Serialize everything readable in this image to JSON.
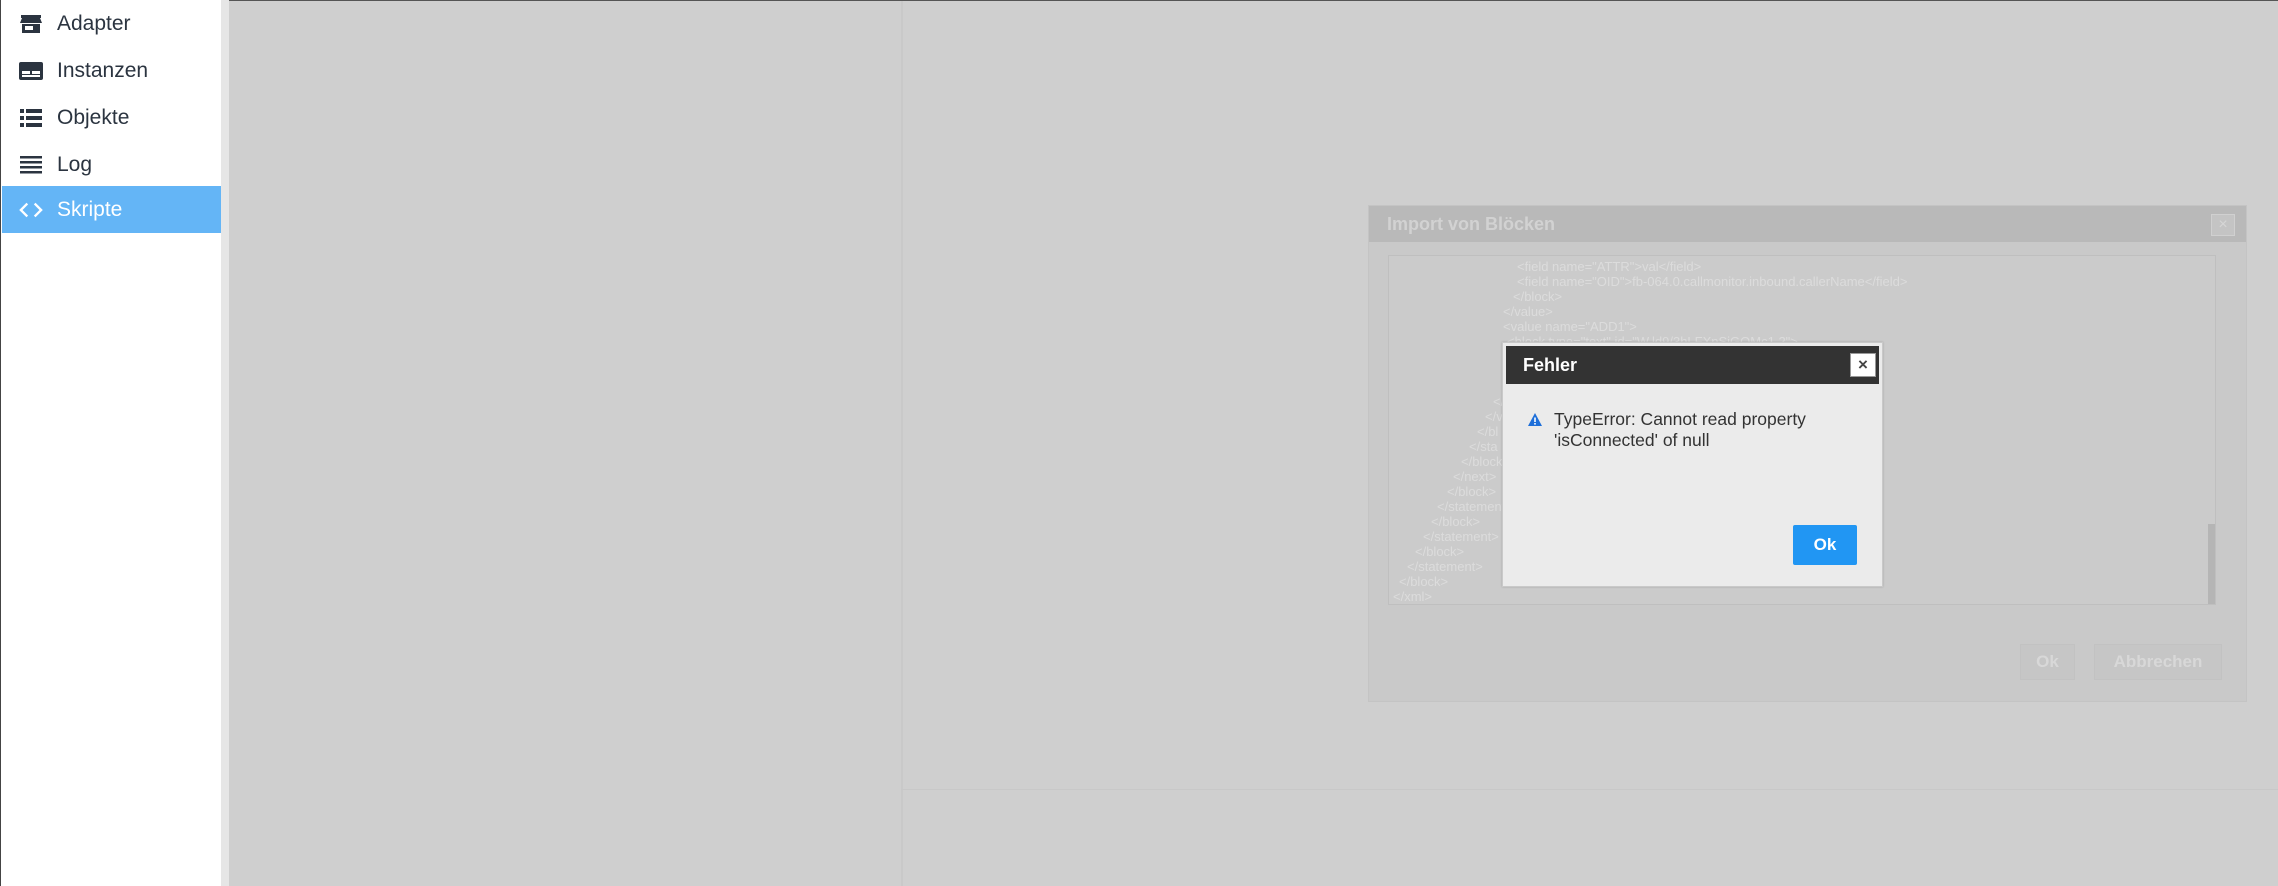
{
  "sidebar": {
    "items": [
      {
        "label": "Adapter",
        "icon": "store-icon",
        "active": false
      },
      {
        "label": "Instanzen",
        "icon": "instances-icon",
        "active": false
      },
      {
        "label": "Objekte",
        "icon": "list-icon",
        "active": false
      },
      {
        "label": "Log",
        "icon": "log-lines-icon",
        "active": false
      },
      {
        "label": "Skripte",
        "icon": "code-icon",
        "active": true
      }
    ],
    "active_color": "#64b5f6"
  },
  "import_dialog": {
    "title": "Import von Blöcken",
    "close_label": "×",
    "code_lines": [
      "<field name=\"ATTR\">val</field>",
      "<field name=\"OID\">fb-064.0.callmonitor.inbound.callerName</field>",
      "</block>",
      "</value>",
      "<value name=\"ADD1\">",
      "<block type=\"text\" id=\"W.ld9/3hLFXnSiGQMc1.2\">",
      "</",
      "</v",
      "</bl",
      "</sta",
      "</block",
      "</next>",
      "</block>",
      "</statement",
      "</block>",
      "</statement>",
      "</block>",
      "</statement>",
      "</block>",
      "</xml>"
    ],
    "ok_label": "Ok",
    "cancel_label": "Abbrechen"
  },
  "error_dialog": {
    "title": "Fehler",
    "close_label": "×",
    "message": "TypeError: Cannot read property 'isConnected' of null",
    "ok_label": "Ok",
    "accent_color": "#2196f3",
    "warning_icon": "warning-icon"
  }
}
